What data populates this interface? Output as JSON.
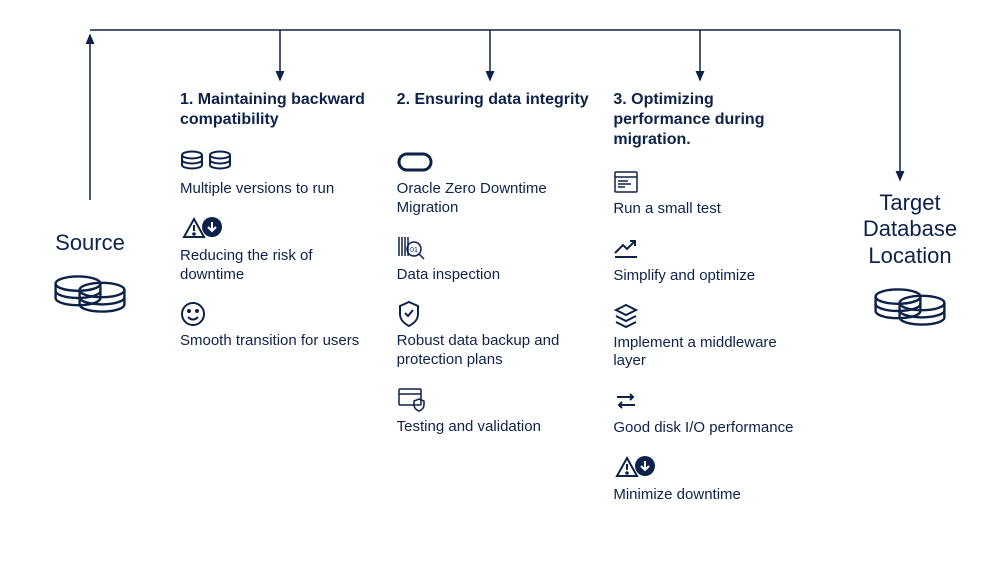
{
  "source": {
    "label": "Source"
  },
  "target": {
    "label": "Target Database Location"
  },
  "columns": [
    {
      "heading": "1. Maintaining backward compatibility",
      "items": [
        {
          "icon": "multi-db",
          "label": "Multiple versions to run"
        },
        {
          "icon": "warn-down",
          "label": "Reducing the risk of downtime"
        },
        {
          "icon": "smile",
          "label": "Smooth transition for users"
        }
      ]
    },
    {
      "heading": "2. Ensuring data integrity",
      "items": [
        {
          "icon": "oval",
          "label": "Oracle Zero Downtime Migration"
        },
        {
          "icon": "inspect",
          "label": "Data inspection"
        },
        {
          "icon": "shield",
          "label": "Robust data backup and protection plans"
        },
        {
          "icon": "window-shield",
          "label": "Testing and validation"
        }
      ]
    },
    {
      "heading": "3. Optimizing performance during migration.",
      "items": [
        {
          "icon": "window-test",
          "label": "Run a small test"
        },
        {
          "icon": "trend-up",
          "label": "Simplify and optimize"
        },
        {
          "icon": "layers",
          "label": "Implement a middleware layer"
        },
        {
          "icon": "io-arrows",
          "label": "Good disk I/O performance"
        },
        {
          "icon": "warn-down",
          "label": "Minimize downtime"
        }
      ]
    }
  ]
}
